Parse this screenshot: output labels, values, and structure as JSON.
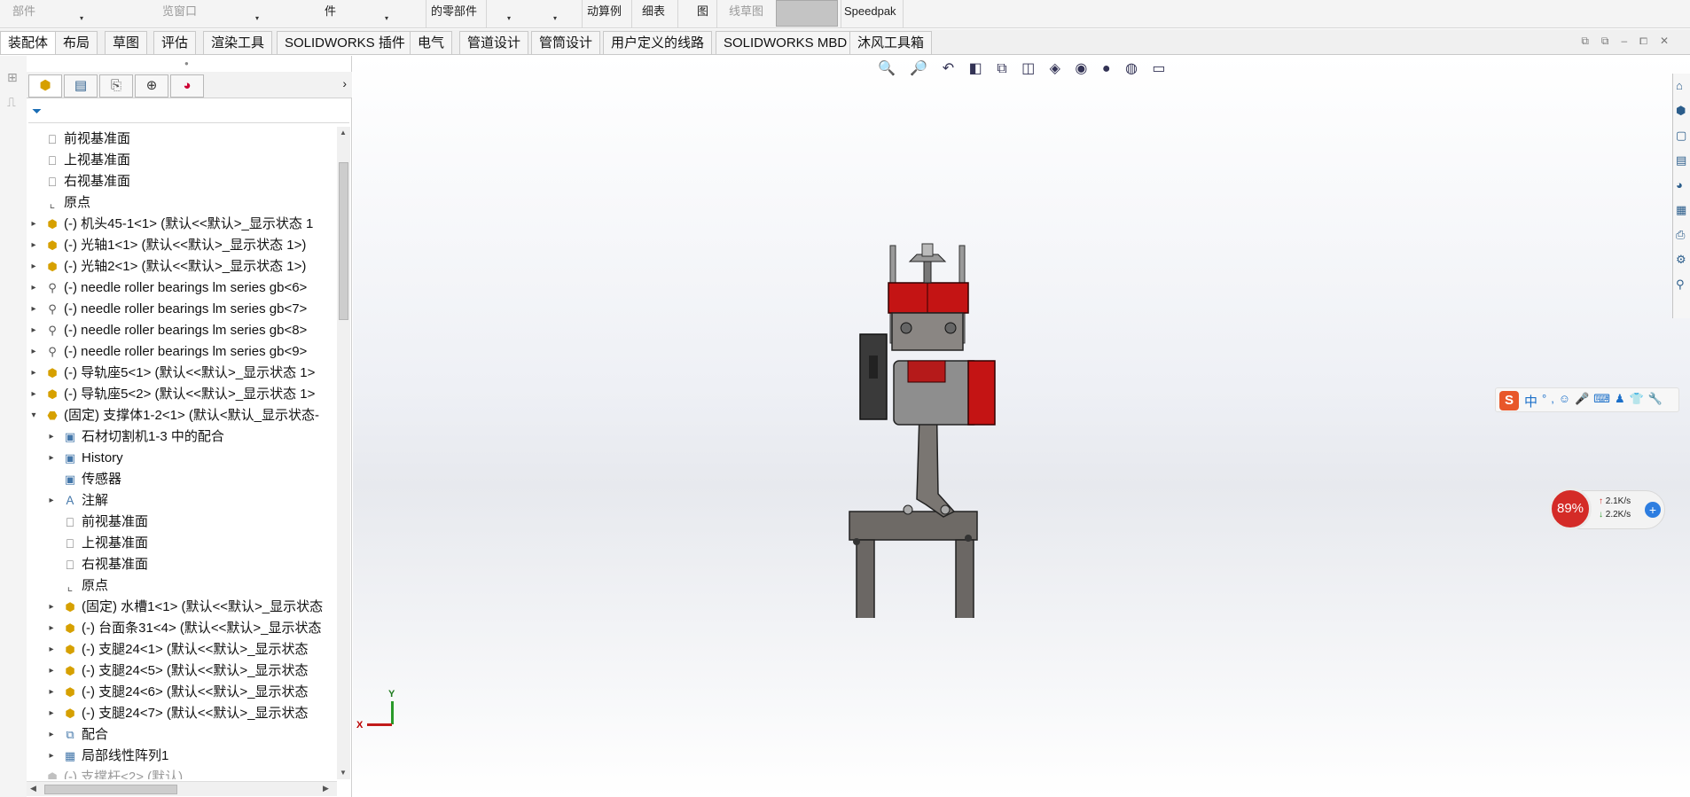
{
  "ribbon": {
    "items": [
      {
        "label": "部件",
        "dim": true
      },
      {
        "label": "览窗口",
        "dim": true
      },
      {
        "label": "件",
        "dim": false
      },
      {
        "label": "的零部件",
        "dim": false
      },
      {
        "label": "动算例",
        "dim": false
      },
      {
        "label": "细表",
        "dim": false
      },
      {
        "label": "图",
        "dim": false
      },
      {
        "label": "线草图",
        "dim": true
      },
      {
        "label": "Speedpak",
        "dim": false
      }
    ]
  },
  "tabs": [
    {
      "label": "装配体",
      "active": true
    },
    {
      "label": "布局"
    },
    {
      "label": "草图"
    },
    {
      "label": "评估"
    },
    {
      "label": "渲染工具"
    },
    {
      "label": "SOLIDWORKS 插件"
    },
    {
      "label": "电气"
    },
    {
      "label": "管道设计"
    },
    {
      "label": "管筒设计"
    },
    {
      "label": "用户定义的线路"
    },
    {
      "label": "SOLIDWORKS MBD"
    },
    {
      "label": "沐风工具箱"
    }
  ],
  "tree": [
    {
      "label": "前视基准面",
      "icon": "plane",
      "indent": 0,
      "arrow": false
    },
    {
      "label": "上视基准面",
      "icon": "plane",
      "indent": 0,
      "arrow": false
    },
    {
      "label": "右视基准面",
      "icon": "plane",
      "indent": 0,
      "arrow": false
    },
    {
      "label": "原点",
      "icon": "origin",
      "indent": 0,
      "arrow": false
    },
    {
      "label": "(-) 机头45-1<1> (默认<<默认>_显示状态 1",
      "icon": "part",
      "indent": 0,
      "arrow": true
    },
    {
      "label": "(-) 光轴1<1> (默认<<默认>_显示状态 1>)",
      "icon": "part",
      "indent": 0,
      "arrow": true
    },
    {
      "label": "(-) 光轴2<1> (默认<<默认>_显示状态 1>)",
      "icon": "part",
      "indent": 0,
      "arrow": true
    },
    {
      "label": "(-) needle roller bearings lm series gb<6>",
      "icon": "bolt",
      "indent": 0,
      "arrow": true
    },
    {
      "label": "(-) needle roller bearings lm series gb<7>",
      "icon": "bolt",
      "indent": 0,
      "arrow": true
    },
    {
      "label": "(-) needle roller bearings lm series gb<8>",
      "icon": "bolt",
      "indent": 0,
      "arrow": true
    },
    {
      "label": "(-) needle roller bearings lm series gb<9>",
      "icon": "bolt",
      "indent": 0,
      "arrow": true
    },
    {
      "label": "(-) 导轨座5<1> (默认<<默认>_显示状态 1>",
      "icon": "part",
      "indent": 0,
      "arrow": true
    },
    {
      "label": "(-) 导轨座5<2> (默认<<默认>_显示状态 1>",
      "icon": "part",
      "indent": 0,
      "arrow": true
    },
    {
      "label": "(固定) 支撑体1-2<1> (默认<默认_显示状态-",
      "icon": "asm",
      "indent": 0,
      "arrow": "open"
    },
    {
      "label": "石材切割机1-3 中的配合",
      "icon": "folder",
      "indent": 1,
      "arrow": true
    },
    {
      "label": "History",
      "icon": "folder",
      "indent": 1,
      "arrow": true
    },
    {
      "label": "传感器",
      "icon": "folder",
      "indent": 1,
      "arrow": false
    },
    {
      "label": "注解",
      "icon": "annot",
      "indent": 1,
      "arrow": true
    },
    {
      "label": "前视基准面",
      "icon": "plane",
      "indent": 1,
      "arrow": false
    },
    {
      "label": "上视基准面",
      "icon": "plane",
      "indent": 1,
      "arrow": false
    },
    {
      "label": "右视基准面",
      "icon": "plane",
      "indent": 1,
      "arrow": false
    },
    {
      "label": "原点",
      "icon": "origin",
      "indent": 1,
      "arrow": false
    },
    {
      "label": "(固定) 水槽1<1> (默认<<默认>_显示状态",
      "icon": "part",
      "indent": 1,
      "arrow": true
    },
    {
      "label": "(-) 台面条31<4> (默认<<默认>_显示状态",
      "icon": "part",
      "indent": 1,
      "arrow": true
    },
    {
      "label": "(-) 支腿24<1> (默认<<默认>_显示状态",
      "icon": "part",
      "indent": 1,
      "arrow": true
    },
    {
      "label": "(-) 支腿24<5> (默认<<默认>_显示状态",
      "icon": "part",
      "indent": 1,
      "arrow": true
    },
    {
      "label": "(-) 支腿24<6> (默认<<默认>_显示状态",
      "icon": "part",
      "indent": 1,
      "arrow": true
    },
    {
      "label": "(-) 支腿24<7> (默认<<默认>_显示状态",
      "icon": "part",
      "indent": 1,
      "arrow": true
    },
    {
      "label": "配合",
      "icon": "mates",
      "indent": 1,
      "arrow": true
    },
    {
      "label": "局部线性阵列1",
      "icon": "pattern",
      "indent": 1,
      "arrow": true
    },
    {
      "label": "(-) 支撑杆<2> (默认)",
      "icon": "part",
      "indent": 0,
      "arrow": false,
      "grayed": true
    }
  ],
  "ime": {
    "logo": "S",
    "mode": "中",
    "tools": "°,☺🎤⌨♟👕🔧"
  },
  "network": {
    "percent": "89%",
    "up": "2.1K/s",
    "down": "2.2K/s"
  },
  "triad": {
    "y": "Y",
    "x": "X"
  },
  "colors": {
    "accent_red": "#d42b27",
    "part_icon": "#d6a000",
    "viewport_bg": "#e9ebf0"
  }
}
